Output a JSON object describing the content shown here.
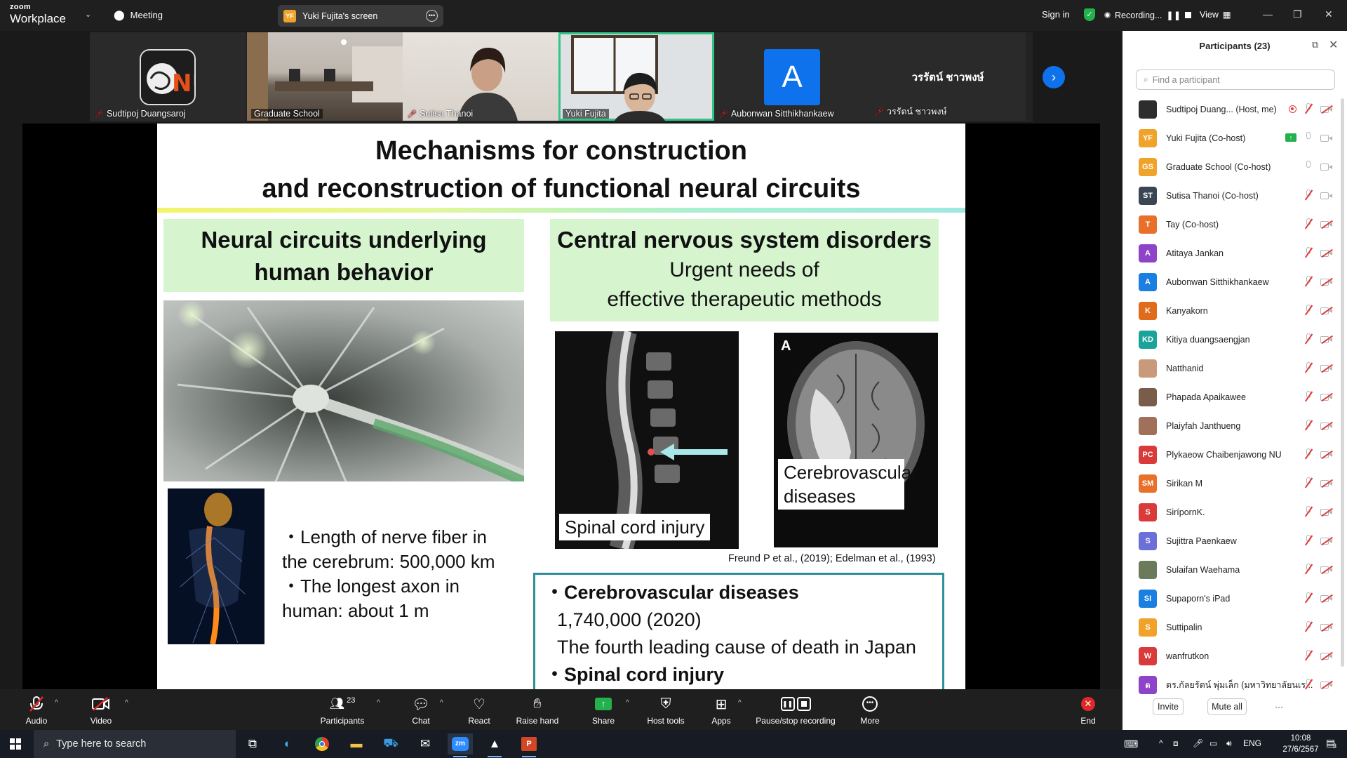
{
  "app": {
    "logo_line1": "zoom",
    "logo_line2": "Workplace",
    "meeting_label": "Meeting",
    "screen_pill_badge": "YF",
    "screen_pill_label": "Yuki Fujita's screen",
    "sign_in": "Sign in",
    "recording": "Recording...",
    "view": "View"
  },
  "thumbnails": [
    {
      "name": "Sudtipoj Duangsaroj",
      "muted": true
    },
    {
      "name": "Graduate School",
      "muted": false
    },
    {
      "name": "Sutisa Thanoi",
      "muted": true
    },
    {
      "name": "Yuki Fujita",
      "muted": false
    },
    {
      "name": "Aubonwan Sitthikhankaew",
      "muted": true,
      "avatar": "A"
    },
    {
      "name": "วรรัตน์ ชาวพงษ์",
      "muted": true,
      "big_name": "วรรัตน์ ชาวพงษ์"
    }
  ],
  "slide": {
    "title_line1": "Mechanisms for construction",
    "title_line2": "and reconstruction of functional neural circuits",
    "left_heading_line1": "Neural circuits underlying",
    "left_heading_line2": "human behavior",
    "right_heading": "Central nervous system disorders",
    "right_sub_line1": "Urgent needs of",
    "right_sub_line2": "effective therapeutic methods",
    "left_bullets": [
      "・Length of nerve fiber in",
      "the cerebrum: 500,000 km",
      "・The longest axon in",
      "human: about 1 m"
    ],
    "mri1_label": "Spinal cord injury",
    "mri2_marker": "A",
    "mri2_label_line1": "Cerebrovascular",
    "mri2_label_line2": "diseases",
    "citation": "Freund P et al.,  (2019); Edelman et al., (1993)",
    "teal_box": {
      "b1": "・Cerebrovascular diseases",
      "l1": "1,740,000 (2020)",
      "l2": "The fourth leading cause of death in Japan",
      "b2": "・Spinal cord injury"
    }
  },
  "participants_panel": {
    "title": "Participants (23)",
    "search_placeholder": "Find a participant",
    "invite": "Invite",
    "mute_all": "Mute all",
    "more": "···",
    "items": [
      {
        "name": "Sudtipoj Duang...  (Host, me)",
        "initials": "",
        "color": "#2d2d2d",
        "rec": true,
        "mic": "muted",
        "cam": "off"
      },
      {
        "name": "Yuki Fujita (Co-host)",
        "initials": "YF",
        "color": "#f0a32a",
        "share": true,
        "mic": "on",
        "cam": "on"
      },
      {
        "name": "Graduate School (Co-host)",
        "initials": "GS",
        "color": "#f0a32a",
        "mic": "on",
        "cam": "on"
      },
      {
        "name": "Sutisa Thanoi (Co-host)",
        "initials": "ST",
        "color": "#3b4654",
        "mic": "muted",
        "cam": "on"
      },
      {
        "name": "Tay (Co-host)",
        "initials": "T",
        "color": "#e8702a",
        "mic": "muted",
        "cam": "off"
      },
      {
        "name": "Atitaya Jankan",
        "initials": "A",
        "color": "#8e44c8",
        "mic": "muted",
        "cam": "off"
      },
      {
        "name": "Aubonwan Sitthikhankaew",
        "initials": "A",
        "color": "#1a7fe0",
        "mic": "muted",
        "cam": "off"
      },
      {
        "name": "Kanyakorn",
        "initials": "K",
        "color": "#e06b1a",
        "mic": "muted",
        "cam": "off"
      },
      {
        "name": "Kitiya duangsaengjan",
        "initials": "KD",
        "color": "#1aa39b",
        "mic": "muted",
        "cam": "off"
      },
      {
        "name": "Natthanid",
        "initials": "",
        "color": "#c99a7a",
        "mic": "muted",
        "cam": "off"
      },
      {
        "name": "Phapada Apaikawee",
        "initials": "",
        "color": "#7a5c4a",
        "mic": "muted",
        "cam": "off"
      },
      {
        "name": "Plaiyfah Janthueng",
        "initials": "",
        "color": "#a0705a",
        "mic": "muted",
        "cam": "off"
      },
      {
        "name": "Plykaeow Chaibenjawong NU",
        "initials": "PC",
        "color": "#d93a3a",
        "mic": "muted",
        "cam": "off"
      },
      {
        "name": "Sirikan M",
        "initials": "SM",
        "color": "#e8702a",
        "mic": "muted",
        "cam": "off"
      },
      {
        "name": "SirípornK.",
        "initials": "S",
        "color": "#d93a3a",
        "mic": "muted",
        "cam": "off"
      },
      {
        "name": "Sujittra Paenkaew",
        "initials": "S",
        "color": "#6b6fd8",
        "mic": "muted",
        "cam": "off"
      },
      {
        "name": "Sulaifan Waehama",
        "initials": "",
        "color": "#6a7a5a",
        "mic": "muted",
        "cam": "off"
      },
      {
        "name": "Supaporn's iPad",
        "initials": "SI",
        "color": "#1a7fe0",
        "mic": "muted",
        "cam": "off"
      },
      {
        "name": "Suttipalin",
        "initials": "S",
        "color": "#f0a32a",
        "mic": "muted",
        "cam": "off"
      },
      {
        "name": "wanfrutkon",
        "initials": "W",
        "color": "#d93a3a",
        "mic": "muted",
        "cam": "off"
      },
      {
        "name": "ดร.กัลยรัตน์ พุ่มเล็ก (มหาวิทยาลัยนเร...",
        "initials": "ด",
        "color": "#8e44c8",
        "mic": "muted",
        "cam": "off"
      }
    ]
  },
  "toolbar": {
    "audio": "Audio",
    "video": "Video",
    "participants": "Participants",
    "participants_count": "23",
    "chat": "Chat",
    "react": "React",
    "raise_hand": "Raise hand",
    "share": "Share",
    "host_tools": "Host tools",
    "apps": "Apps",
    "pause_recording": "Pause/stop recording",
    "more": "More",
    "end": "End"
  },
  "taskbar": {
    "search_placeholder": "Type here to search",
    "zoom_app": "zm",
    "lang": "ENG",
    "time": "10:08",
    "date": "27/6/2567",
    "notifications": "3"
  }
}
